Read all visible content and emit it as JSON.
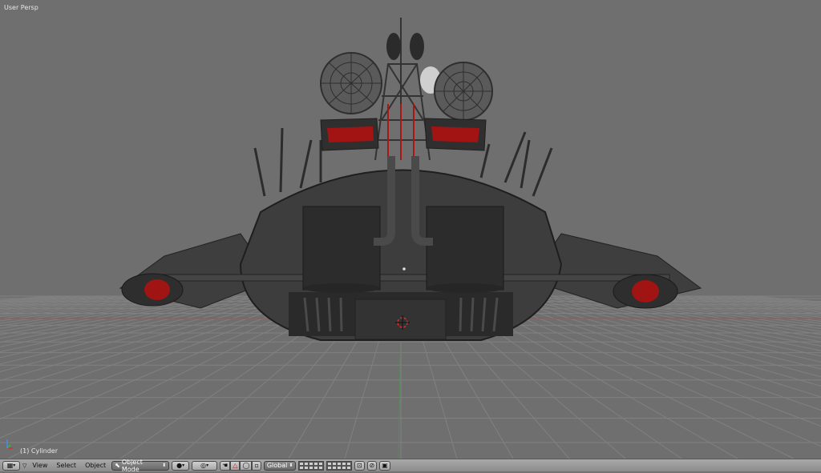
{
  "viewport": {
    "view_name": "User Persp",
    "object_label": "(1) Cylinder"
  },
  "header": {
    "menus": [
      "View",
      "Select",
      "Object"
    ],
    "mode": "Object Mode",
    "orientation": "Global",
    "icons": {
      "editor_type": "grid-icon",
      "shading": "sphere-icon",
      "pivot": "pivot-icon",
      "manipulator": "hand-icon",
      "translate": "triangle-icon",
      "rotate": "circle-icon",
      "lock": "lock-icon",
      "render": "camera-icon",
      "opengl": "screen-icon"
    }
  },
  "colors": {
    "viewport_bg": "#6f6f6f",
    "grid": "#808080",
    "x_axis": "#8a4a4a",
    "y_axis": "#4a8a4a",
    "ship_body": "#3a3a3a",
    "accent_red": "#b01818"
  }
}
